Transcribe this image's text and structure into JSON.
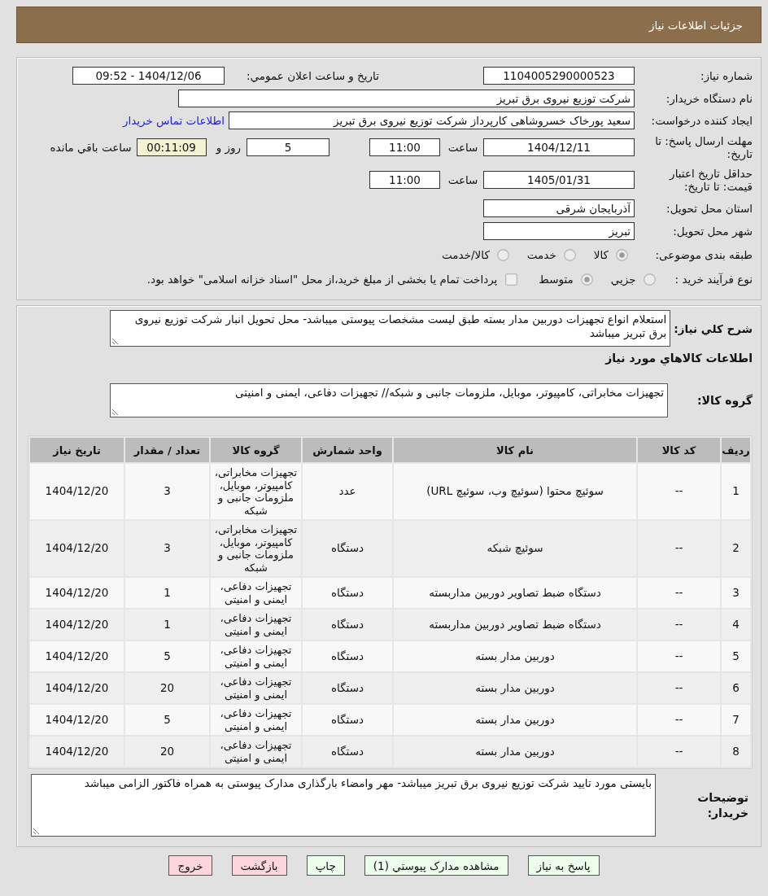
{
  "header": {
    "title": "جزئیات اطلاعات نیاز"
  },
  "details": {
    "need_number": {
      "label": "شماره نیاز:",
      "value": "1104005290000523"
    },
    "announce_datetime": {
      "label": "تاریخ و ساعت اعلان عمومي:",
      "value": "1404/12/06 - 09:52"
    },
    "buyer_org": {
      "label": "نام دستگاه خریدار:",
      "value": "شرکت توزیع نیروی برق تبریز"
    },
    "requester": {
      "label": "ایجاد کننده درخواست:",
      "value": "سعید پورخاک خسروشاهی کارپرداز شرکت توزیع نیروی برق تبریز",
      "link": "اطلاعات تماس خریدار"
    },
    "reply_deadline": {
      "label": "مهلت ارسال پاسخ: تا تاریخ:",
      "date": "1404/12/11",
      "time_label": "ساعت",
      "time": "11:00",
      "days": "5",
      "days_label": "روز و",
      "remaining": "00:11:09",
      "remaining_label": "ساعت باقي مانده"
    },
    "price_validity": {
      "label": "حداقل تاریخ اعتبار قیمت: تا تاریخ:",
      "date": "1405/01/31",
      "time_label": "ساعت",
      "time": "11:00"
    },
    "province": {
      "label": "استان محل تحویل:",
      "value": "آذربایجان شرقی"
    },
    "city": {
      "label": "شهر محل تحویل:",
      "value": "تبریز"
    },
    "category": {
      "label": "طبقه بندی موضوعی:",
      "options": [
        {
          "label": "کالا",
          "selected": true
        },
        {
          "label": "خدمت",
          "selected": false
        },
        {
          "label": "کالا/خدمت",
          "selected": false
        }
      ]
    },
    "purchase_type": {
      "label": "نوع فرآیند خرید :",
      "options": [
        {
          "label": "جزيي",
          "selected": false
        },
        {
          "label": "متوسط",
          "selected": true
        }
      ],
      "treasury": {
        "label": "پرداخت تمام یا بخشی از مبلغ خرید،از محل \"اسناد خزانه اسلامی\" خواهد بود.",
        "checked": false
      }
    }
  },
  "summary": {
    "label": "شرح کلي نیاز:",
    "value": "استعلام انواع تجهیزات دوربین مدار بسته طبق لیست مشخصات پیوستی میباشد- محل تحویل انبار شرکت توزیع نیروی برق تبریز میباشد"
  },
  "goods": {
    "title": "اطلاعات کالاهاي مورد نیاز",
    "group_label": "گروه کالا:",
    "group_value": "تجهیزات مخابراتی، کامپیوتر، موبایل، ملزومات جانبی و شبکه// تجهیزات دفاعی، ایمنی و امنیتی",
    "table": {
      "columns": [
        "ردیف",
        "کد کالا",
        "نام کالا",
        "واحد شمارش",
        "گروه کالا",
        "تعداد / مقدار",
        "تاریخ نیاز"
      ],
      "rows": [
        {
          "index": "1",
          "code": "--",
          "name": "سوئیچ محتوا (سوئیچ وب، سوئیچ URL)",
          "unit": "عدد",
          "group": "تجهیزات مخابراتی، کامپیوتر، موبایل، ملزومات جانبی و شبکه",
          "quantity": "3",
          "date": "1404/12/20"
        },
        {
          "index": "2",
          "code": "--",
          "name": "سوئیچ شبکه",
          "unit": "دستگاه",
          "group": "تجهیزات مخابراتی، کامپیوتر، موبایل، ملزومات جانبی و شبکه",
          "quantity": "3",
          "date": "1404/12/20"
        },
        {
          "index": "3",
          "code": "--",
          "name": "دستگاه ضبط تصاویر دوربین مداربسته",
          "unit": "دستگاه",
          "group": "تجهیزات دفاعی، ایمنی و امنیتی",
          "quantity": "1",
          "date": "1404/12/20"
        },
        {
          "index": "4",
          "code": "--",
          "name": "دستگاه ضبط تصاویر دوربین مداربسته",
          "unit": "دستگاه",
          "group": "تجهیزات دفاعی، ایمنی و امنیتی",
          "quantity": "1",
          "date": "1404/12/20"
        },
        {
          "index": "5",
          "code": "--",
          "name": "دوربین مدار بسته",
          "unit": "دستگاه",
          "group": "تجهیزات دفاعی، ایمنی و امنیتی",
          "quantity": "5",
          "date": "1404/12/20"
        },
        {
          "index": "6",
          "code": "--",
          "name": "دوربین مدار بسته",
          "unit": "دستگاه",
          "group": "تجهیزات دفاعی، ایمنی و امنیتی",
          "quantity": "20",
          "date": "1404/12/20"
        },
        {
          "index": "7",
          "code": "--",
          "name": "دوربین مدار بسته",
          "unit": "دستگاه",
          "group": "تجهیزات دفاعی، ایمنی و امنیتی",
          "quantity": "5",
          "date": "1404/12/20"
        },
        {
          "index": "8",
          "code": "--",
          "name": "دوربین مدار بسته",
          "unit": "دستگاه",
          "group": "تجهیزات دفاعی، ایمنی و امنیتی",
          "quantity": "20",
          "date": "1404/12/20"
        }
      ]
    }
  },
  "buyer_notes": {
    "label": "توضیحات خریدار:",
    "value": "بایستی مورد تایید شرکت توزیع نیروی برق تبریز میباشد- مهر وامضاء بارگذاری مدارک پیوستی به همراه فاکتور الزامی میباشد"
  },
  "buttons": [
    {
      "label": "پاسخ به نیاز",
      "kind": "action"
    },
    {
      "label": "مشاهده مدارک پیوستي (1)",
      "kind": "action"
    },
    {
      "label": "چاپ",
      "kind": "action"
    },
    {
      "label": "بازگشت",
      "kind": "exit"
    },
    {
      "label": "خروج",
      "kind": "exit"
    }
  ]
}
